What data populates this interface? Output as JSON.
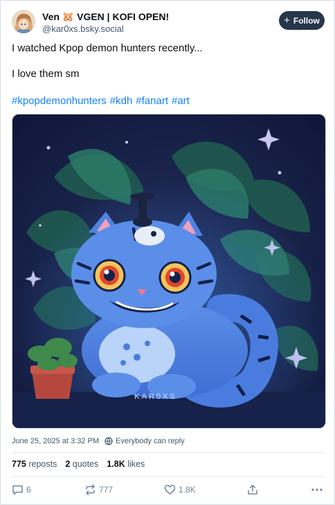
{
  "author": {
    "display_name": "Ven 🐹 VGEN | KOFI OPEN!",
    "handle": "@kar0xs.bsky.social"
  },
  "follow_button": {
    "label": "Follow",
    "icon": "plus-icon"
  },
  "post": {
    "lines": [
      "I watched Kpop demon hunters recently...",
      "I love them sm"
    ],
    "hashtags": [
      "#kpopdemonhunters",
      "#kdh",
      "#fanart",
      "#art"
    ],
    "image_signature": "KAR0XS"
  },
  "meta": {
    "timestamp": "June 25, 2025 at 3:32 PM",
    "reply_setting": "Everybody can reply"
  },
  "stats": {
    "reposts_count": "775",
    "reposts_label": "reposts",
    "quotes_count": "2",
    "quotes_label": "quotes",
    "likes_count": "1.8K",
    "likes_label": "likes"
  },
  "actions": {
    "reply_count": "6",
    "repost_count": "777",
    "like_count": "1.8K"
  },
  "colors": {
    "link": "#1083fe",
    "follow_bg": "#27364a",
    "muted_text": "#42576c"
  }
}
